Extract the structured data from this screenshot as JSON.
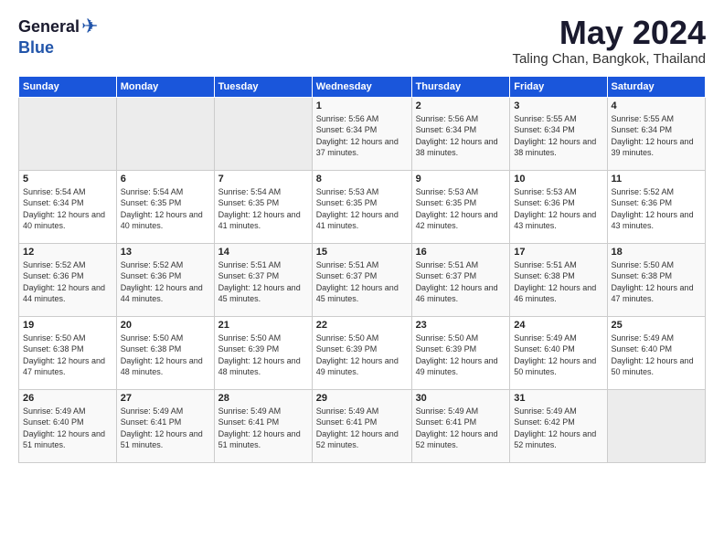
{
  "header": {
    "logo": {
      "general": "General",
      "blue": "Blue"
    },
    "title": "May 2024",
    "location": "Taling Chan, Bangkok, Thailand"
  },
  "weekdays": [
    "Sunday",
    "Monday",
    "Tuesday",
    "Wednesday",
    "Thursday",
    "Friday",
    "Saturday"
  ],
  "weeks": [
    [
      null,
      null,
      null,
      {
        "day": "1",
        "sunrise": "Sunrise: 5:56 AM",
        "sunset": "Sunset: 6:34 PM",
        "daylight": "Daylight: 12 hours and 37 minutes."
      },
      {
        "day": "2",
        "sunrise": "Sunrise: 5:56 AM",
        "sunset": "Sunset: 6:34 PM",
        "daylight": "Daylight: 12 hours and 38 minutes."
      },
      {
        "day": "3",
        "sunrise": "Sunrise: 5:55 AM",
        "sunset": "Sunset: 6:34 PM",
        "daylight": "Daylight: 12 hours and 38 minutes."
      },
      {
        "day": "4",
        "sunrise": "Sunrise: 5:55 AM",
        "sunset": "Sunset: 6:34 PM",
        "daylight": "Daylight: 12 hours and 39 minutes."
      }
    ],
    [
      {
        "day": "5",
        "sunrise": "Sunrise: 5:54 AM",
        "sunset": "Sunset: 6:34 PM",
        "daylight": "Daylight: 12 hours and 40 minutes."
      },
      {
        "day": "6",
        "sunrise": "Sunrise: 5:54 AM",
        "sunset": "Sunset: 6:35 PM",
        "daylight": "Daylight: 12 hours and 40 minutes."
      },
      {
        "day": "7",
        "sunrise": "Sunrise: 5:54 AM",
        "sunset": "Sunset: 6:35 PM",
        "daylight": "Daylight: 12 hours and 41 minutes."
      },
      {
        "day": "8",
        "sunrise": "Sunrise: 5:53 AM",
        "sunset": "Sunset: 6:35 PM",
        "daylight": "Daylight: 12 hours and 41 minutes."
      },
      {
        "day": "9",
        "sunrise": "Sunrise: 5:53 AM",
        "sunset": "Sunset: 6:35 PM",
        "daylight": "Daylight: 12 hours and 42 minutes."
      },
      {
        "day": "10",
        "sunrise": "Sunrise: 5:53 AM",
        "sunset": "Sunset: 6:36 PM",
        "daylight": "Daylight: 12 hours and 43 minutes."
      },
      {
        "day": "11",
        "sunrise": "Sunrise: 5:52 AM",
        "sunset": "Sunset: 6:36 PM",
        "daylight": "Daylight: 12 hours and 43 minutes."
      }
    ],
    [
      {
        "day": "12",
        "sunrise": "Sunrise: 5:52 AM",
        "sunset": "Sunset: 6:36 PM",
        "daylight": "Daylight: 12 hours and 44 minutes."
      },
      {
        "day": "13",
        "sunrise": "Sunrise: 5:52 AM",
        "sunset": "Sunset: 6:36 PM",
        "daylight": "Daylight: 12 hours and 44 minutes."
      },
      {
        "day": "14",
        "sunrise": "Sunrise: 5:51 AM",
        "sunset": "Sunset: 6:37 PM",
        "daylight": "Daylight: 12 hours and 45 minutes."
      },
      {
        "day": "15",
        "sunrise": "Sunrise: 5:51 AM",
        "sunset": "Sunset: 6:37 PM",
        "daylight": "Daylight: 12 hours and 45 minutes."
      },
      {
        "day": "16",
        "sunrise": "Sunrise: 5:51 AM",
        "sunset": "Sunset: 6:37 PM",
        "daylight": "Daylight: 12 hours and 46 minutes."
      },
      {
        "day": "17",
        "sunrise": "Sunrise: 5:51 AM",
        "sunset": "Sunset: 6:38 PM",
        "daylight": "Daylight: 12 hours and 46 minutes."
      },
      {
        "day": "18",
        "sunrise": "Sunrise: 5:50 AM",
        "sunset": "Sunset: 6:38 PM",
        "daylight": "Daylight: 12 hours and 47 minutes."
      }
    ],
    [
      {
        "day": "19",
        "sunrise": "Sunrise: 5:50 AM",
        "sunset": "Sunset: 6:38 PM",
        "daylight": "Daylight: 12 hours and 47 minutes."
      },
      {
        "day": "20",
        "sunrise": "Sunrise: 5:50 AM",
        "sunset": "Sunset: 6:38 PM",
        "daylight": "Daylight: 12 hours and 48 minutes."
      },
      {
        "day": "21",
        "sunrise": "Sunrise: 5:50 AM",
        "sunset": "Sunset: 6:39 PM",
        "daylight": "Daylight: 12 hours and 48 minutes."
      },
      {
        "day": "22",
        "sunrise": "Sunrise: 5:50 AM",
        "sunset": "Sunset: 6:39 PM",
        "daylight": "Daylight: 12 hours and 49 minutes."
      },
      {
        "day": "23",
        "sunrise": "Sunrise: 5:50 AM",
        "sunset": "Sunset: 6:39 PM",
        "daylight": "Daylight: 12 hours and 49 minutes."
      },
      {
        "day": "24",
        "sunrise": "Sunrise: 5:49 AM",
        "sunset": "Sunset: 6:40 PM",
        "daylight": "Daylight: 12 hours and 50 minutes."
      },
      {
        "day": "25",
        "sunrise": "Sunrise: 5:49 AM",
        "sunset": "Sunset: 6:40 PM",
        "daylight": "Daylight: 12 hours and 50 minutes."
      }
    ],
    [
      {
        "day": "26",
        "sunrise": "Sunrise: 5:49 AM",
        "sunset": "Sunset: 6:40 PM",
        "daylight": "Daylight: 12 hours and 51 minutes."
      },
      {
        "day": "27",
        "sunrise": "Sunrise: 5:49 AM",
        "sunset": "Sunset: 6:41 PM",
        "daylight": "Daylight: 12 hours and 51 minutes."
      },
      {
        "day": "28",
        "sunrise": "Sunrise: 5:49 AM",
        "sunset": "Sunset: 6:41 PM",
        "daylight": "Daylight: 12 hours and 51 minutes."
      },
      {
        "day": "29",
        "sunrise": "Sunrise: 5:49 AM",
        "sunset": "Sunset: 6:41 PM",
        "daylight": "Daylight: 12 hours and 52 minutes."
      },
      {
        "day": "30",
        "sunrise": "Sunrise: 5:49 AM",
        "sunset": "Sunset: 6:41 PM",
        "daylight": "Daylight: 12 hours and 52 minutes."
      },
      {
        "day": "31",
        "sunrise": "Sunrise: 5:49 AM",
        "sunset": "Sunset: 6:42 PM",
        "daylight": "Daylight: 12 hours and 52 minutes."
      },
      null
    ]
  ]
}
